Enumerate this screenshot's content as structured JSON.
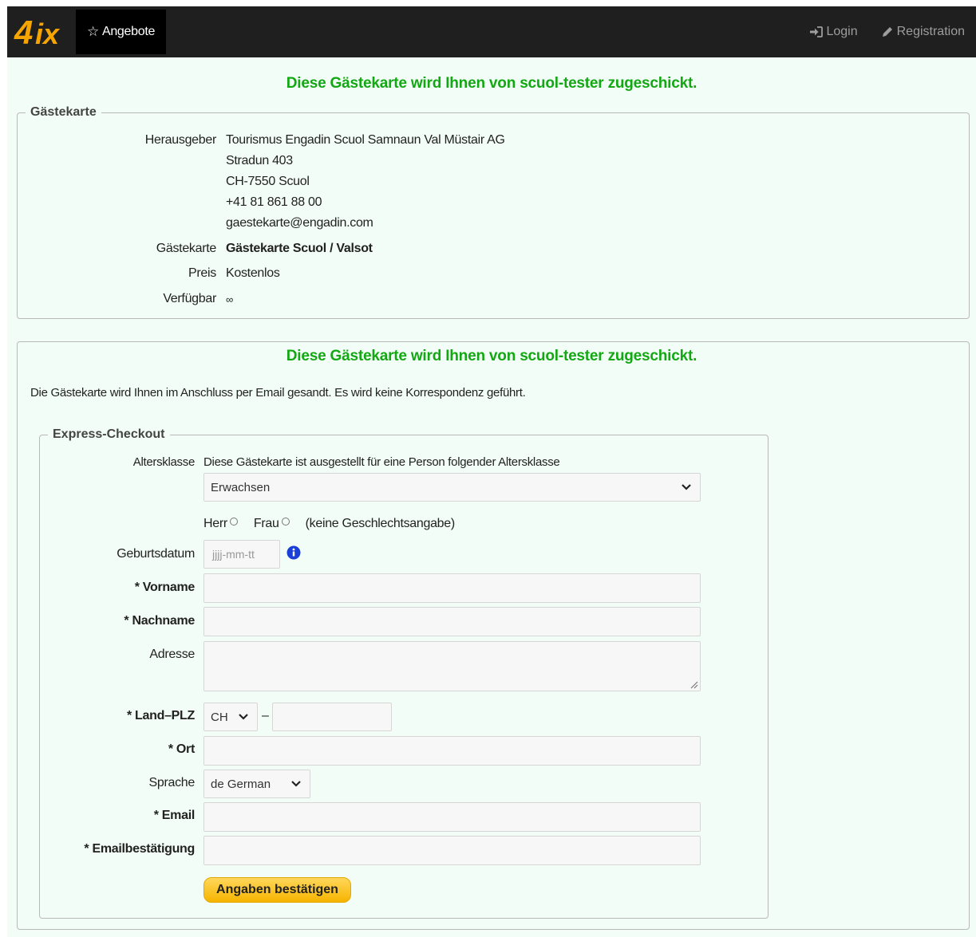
{
  "nav": {
    "logo_text": "4ix",
    "tab_label": "Angebote",
    "login_label": "Login",
    "registration_label": "Registration"
  },
  "heading": "Diese Gästekarte wird Ihnen von scuol-tester zugeschickt.",
  "card": {
    "legend": "Gästekarte",
    "publisher_label": "Herausgeber",
    "publisher_lines": [
      "Tourismus Engadin Scuol Samnaun Val Müstair AG",
      "Stradun 403",
      "CH-7550 Scuol",
      "+41 81 861 88 00",
      "gaestekarte@engadin.com"
    ],
    "card_label": "Gästekarte",
    "card_value": "Gästekarte Scuol / Valsot",
    "price_label": "Preis",
    "price_value": "Kostenlos",
    "available_label": "Verfügbar",
    "available_value": "∞"
  },
  "order": {
    "heading": "Diese Gästekarte wird Ihnen von scuol-tester zugeschickt.",
    "note": "Die Gästekarte wird Ihnen im Anschluss per Email gesandt. Es wird keine Korrespondenz geführt.",
    "legend": "Express-Checkout",
    "age_label": "Altersklasse",
    "age_text": "Diese Gästekarte ist ausgestellt für eine Person folgender Altersklasse",
    "age_selected": "Erwachsen",
    "gender_herr": "Herr",
    "gender_frau": "Frau",
    "gender_none": "(keine Geschlechtsangabe)",
    "birth_label": "Geburtsdatum",
    "birth_placeholder": "jjjj-mm-tt",
    "firstname_label": "* Vorname",
    "lastname_label": "* Nachname",
    "address_label": "Adresse",
    "country_zip_label": "* Land–PLZ",
    "country_selected": "CH",
    "dash": "–",
    "city_label": "* Ort",
    "language_label": "Sprache",
    "language_selected": "de German",
    "email_label": "* Email",
    "email_confirm_label": "* Emailbestätigung",
    "submit_label": "Angaben bestätigen"
  },
  "colors": {
    "accent_green": "#13a813",
    "button_yellow": "#f6b400",
    "info_blue": "#1a3fd6"
  }
}
